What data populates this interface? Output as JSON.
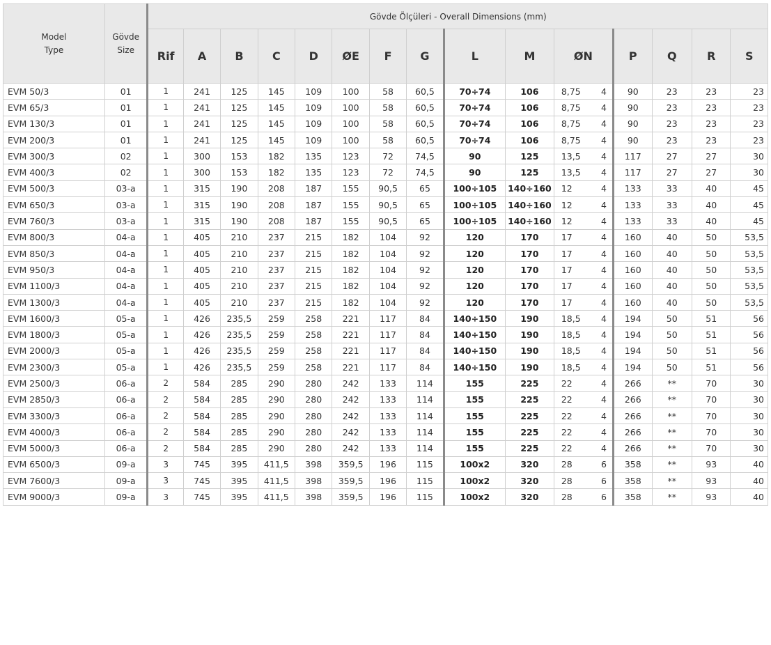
{
  "header": {
    "model_type_line1": "Model",
    "model_type_line2": "Type",
    "size_line1": "Gövde",
    "size_line2": "Size",
    "group_title": "Gövde Ölçüleri - Overall Dimensions (mm)",
    "columns": [
      "Rif",
      "A",
      "B",
      "C",
      "D",
      "ØE",
      "F",
      "G",
      "L",
      "M",
      "ØN",
      "P",
      "Q",
      "R",
      "S"
    ]
  },
  "rows": [
    [
      "EVM 50/3",
      "01",
      "1",
      "241",
      "125",
      "145",
      "109",
      "100",
      "58",
      "60,5",
      "70÷74",
      "106",
      "8,75",
      "4",
      "90",
      "23",
      "23",
      "23"
    ],
    [
      "EVM 65/3",
      "01",
      "1",
      "241",
      "125",
      "145",
      "109",
      "100",
      "58",
      "60,5",
      "70÷74",
      "106",
      "8,75",
      "4",
      "90",
      "23",
      "23",
      "23"
    ],
    [
      "EVM 130/3",
      "01",
      "1",
      "241",
      "125",
      "145",
      "109",
      "100",
      "58",
      "60,5",
      "70÷74",
      "106",
      "8,75",
      "4",
      "90",
      "23",
      "23",
      "23"
    ],
    [
      "EVM 200/3",
      "01",
      "1",
      "241",
      "125",
      "145",
      "109",
      "100",
      "58",
      "60,5",
      "70÷74",
      "106",
      "8,75",
      "4",
      "90",
      "23",
      "23",
      "23"
    ],
    [
      "EVM 300/3",
      "02",
      "1",
      "300",
      "153",
      "182",
      "135",
      "123",
      "72",
      "74,5",
      "90",
      "125",
      "13,5",
      "4",
      "117",
      "27",
      "27",
      "30"
    ],
    [
      "EVM 400/3",
      "02",
      "1",
      "300",
      "153",
      "182",
      "135",
      "123",
      "72",
      "74,5",
      "90",
      "125",
      "13,5",
      "4",
      "117",
      "27",
      "27",
      "30"
    ],
    [
      "EVM 500/3",
      "03-a",
      "1",
      "315",
      "190",
      "208",
      "187",
      "155",
      "90,5",
      "65",
      "100÷105",
      "140÷160",
      "12",
      "4",
      "133",
      "33",
      "40",
      "45"
    ],
    [
      "EVM 650/3",
      "03-a",
      "1",
      "315",
      "190",
      "208",
      "187",
      "155",
      "90,5",
      "65",
      "100÷105",
      "140÷160",
      "12",
      "4",
      "133",
      "33",
      "40",
      "45"
    ],
    [
      "EVM 760/3",
      "03-a",
      "1",
      "315",
      "190",
      "208",
      "187",
      "155",
      "90,5",
      "65",
      "100÷105",
      "140÷160",
      "12",
      "4",
      "133",
      "33",
      "40",
      "45"
    ],
    [
      "EVM 800/3",
      "04-a",
      "1",
      "405",
      "210",
      "237",
      "215",
      "182",
      "104",
      "92",
      "120",
      "170",
      "17",
      "4",
      "160",
      "40",
      "50",
      "53,5"
    ],
    [
      "EVM 850/3",
      "04-a",
      "1",
      "405",
      "210",
      "237",
      "215",
      "182",
      "104",
      "92",
      "120",
      "170",
      "17",
      "4",
      "160",
      "40",
      "50",
      "53,5"
    ],
    [
      "EVM 950/3",
      "04-a",
      "1",
      "405",
      "210",
      "237",
      "215",
      "182",
      "104",
      "92",
      "120",
      "170",
      "17",
      "4",
      "160",
      "40",
      "50",
      "53,5"
    ],
    [
      "EVM 1100/3",
      "04-a",
      "1",
      "405",
      "210",
      "237",
      "215",
      "182",
      "104",
      "92",
      "120",
      "170",
      "17",
      "4",
      "160",
      "40",
      "50",
      "53,5"
    ],
    [
      "EVM 1300/3",
      "04-a",
      "1",
      "405",
      "210",
      "237",
      "215",
      "182",
      "104",
      "92",
      "120",
      "170",
      "17",
      "4",
      "160",
      "40",
      "50",
      "53,5"
    ],
    [
      "EVM 1600/3",
      "05-a",
      "1",
      "426",
      "235,5",
      "259",
      "258",
      "221",
      "117",
      "84",
      "140÷150",
      "190",
      "18,5",
      "4",
      "194",
      "50",
      "51",
      "56"
    ],
    [
      "EVM 1800/3",
      "05-a",
      "1",
      "426",
      "235,5",
      "259",
      "258",
      "221",
      "117",
      "84",
      "140÷150",
      "190",
      "18,5",
      "4",
      "194",
      "50",
      "51",
      "56"
    ],
    [
      "EVM 2000/3",
      "05-a",
      "1",
      "426",
      "235,5",
      "259",
      "258",
      "221",
      "117",
      "84",
      "140÷150",
      "190",
      "18,5",
      "4",
      "194",
      "50",
      "51",
      "56"
    ],
    [
      "EVM 2300/3",
      "05-a",
      "1",
      "426",
      "235,5",
      "259",
      "258",
      "221",
      "117",
      "84",
      "140÷150",
      "190",
      "18,5",
      "4",
      "194",
      "50",
      "51",
      "56"
    ],
    [
      "EVM 2500/3",
      "06-a",
      "2",
      "584",
      "285",
      "290",
      "280",
      "242",
      "133",
      "114",
      "155",
      "225",
      "22",
      "4",
      "266",
      "**",
      "70",
      "30"
    ],
    [
      "EVM 2850/3",
      "06-a",
      "2",
      "584",
      "285",
      "290",
      "280",
      "242",
      "133",
      "114",
      "155",
      "225",
      "22",
      "4",
      "266",
      "**",
      "70",
      "30"
    ],
    [
      "EVM 3300/3",
      "06-a",
      "2",
      "584",
      "285",
      "290",
      "280",
      "242",
      "133",
      "114",
      "155",
      "225",
      "22",
      "4",
      "266",
      "**",
      "70",
      "30"
    ],
    [
      "EVM 4000/3",
      "06-a",
      "2",
      "584",
      "285",
      "290",
      "280",
      "242",
      "133",
      "114",
      "155",
      "225",
      "22",
      "4",
      "266",
      "**",
      "70",
      "30"
    ],
    [
      "EVM 5000/3",
      "06-a",
      "2",
      "584",
      "285",
      "290",
      "280",
      "242",
      "133",
      "114",
      "155",
      "225",
      "22",
      "4",
      "266",
      "**",
      "70",
      "30"
    ],
    [
      "EVM 6500/3",
      "09-a",
      "3",
      "745",
      "395",
      "411,5",
      "398",
      "359,5",
      "196",
      "115",
      "100x2",
      "320",
      "28",
      "6",
      "358",
      "**",
      "93",
      "40"
    ],
    [
      "EVM 7600/3",
      "09-a",
      "3",
      "745",
      "395",
      "411,5",
      "398",
      "359,5",
      "196",
      "115",
      "100x2",
      "320",
      "28",
      "6",
      "358",
      "**",
      "93",
      "40"
    ],
    [
      "EVM 9000/3",
      "09-a",
      "3",
      "745",
      "395",
      "411,5",
      "398",
      "359,5",
      "196",
      "115",
      "100x2",
      "320",
      "28",
      "6",
      "358",
      "**",
      "93",
      "40"
    ]
  ]
}
